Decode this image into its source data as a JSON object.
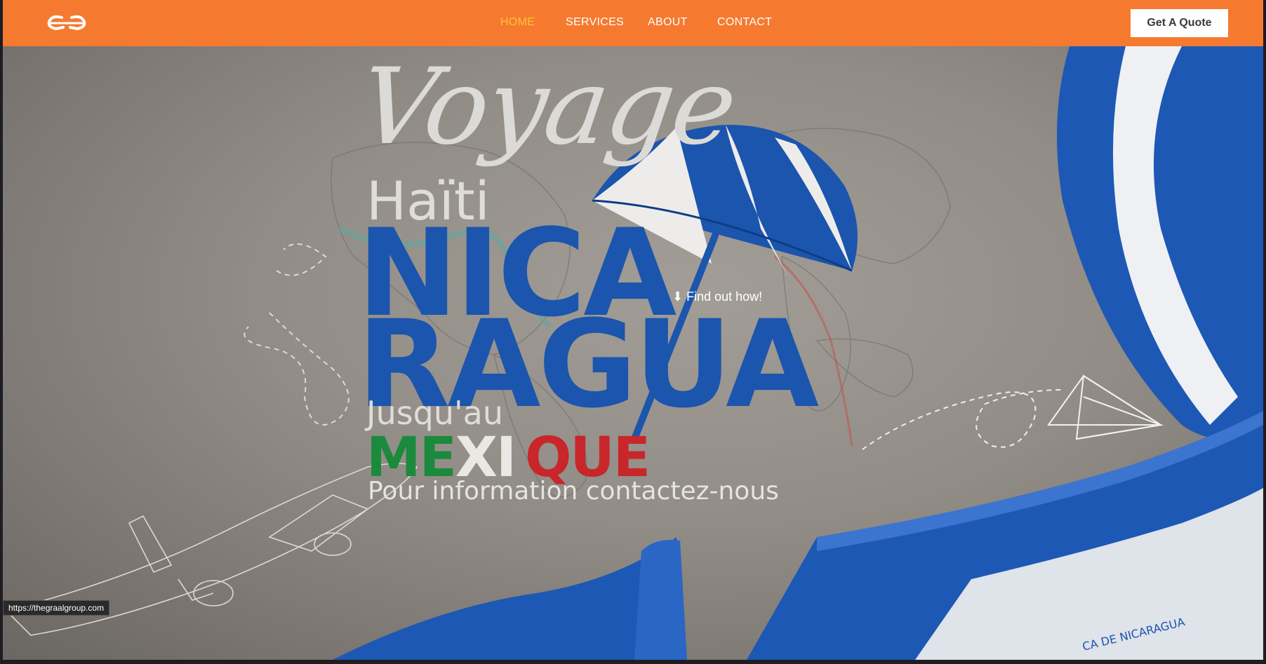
{
  "header": {
    "logo_icon": "gg-monogram-logo",
    "nav": [
      {
        "label": "HOME",
        "active": true
      },
      {
        "label": "SERVICES",
        "active": false
      },
      {
        "label": "ABOUT",
        "active": false
      },
      {
        "label": "CONTACT",
        "active": false
      }
    ],
    "cta_label": "Get A Quote"
  },
  "hero": {
    "script_title": "Voyage",
    "origin": "Haïti",
    "destination_line1": "NICA",
    "destination_line2": "RAGUA",
    "connector": "Jusqu'au",
    "country2_part1": "ME",
    "country2_part2": "XI",
    "country2_part3": "QUE",
    "contact_line": "Pour information contactez-nous",
    "find_out_link": "Find out how!",
    "find_out_icon": "arrow-down-icon",
    "seal_text": "CA DE NICARAGUA"
  },
  "status_bar": {
    "url": "https://thegraalgroup.com"
  },
  "colors": {
    "header_bg": "#f57a30",
    "nav_active": "#ffc233",
    "nicaragua_blue": "#1b55ad",
    "mexico_green": "#1b8a3d",
    "mexico_red": "#c8262a"
  }
}
